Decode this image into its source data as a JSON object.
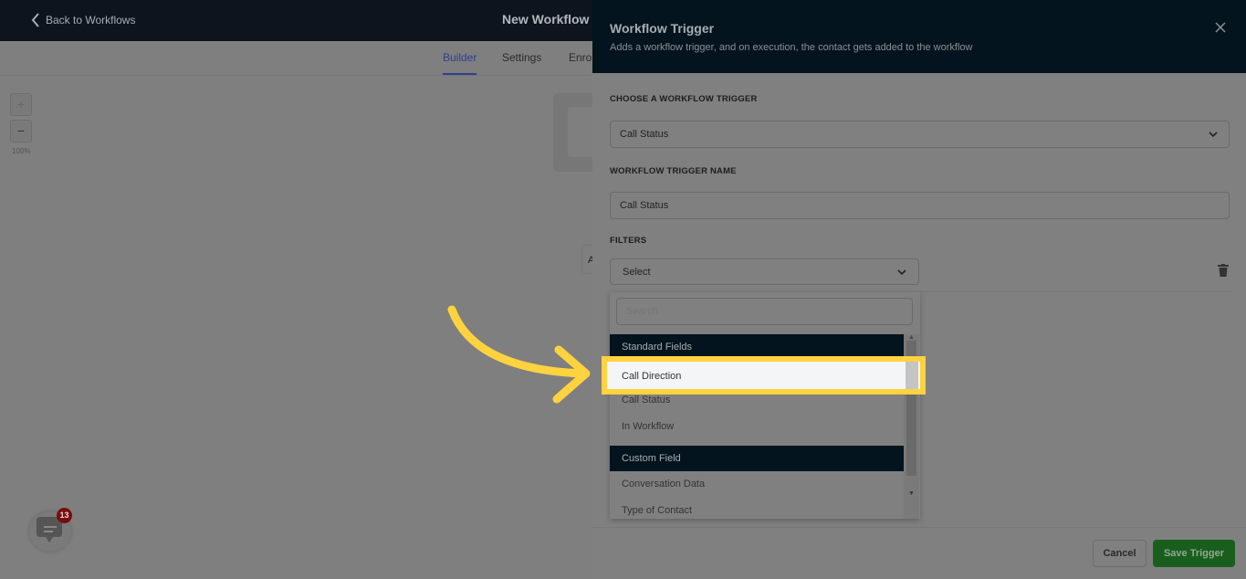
{
  "topbar": {
    "back_label": "Back to Workflows",
    "title": "New Workflow"
  },
  "tabs": [
    {
      "label": "Builder",
      "active": true
    },
    {
      "label": "Settings"
    },
    {
      "label": "Enro"
    }
  ],
  "canvas": {
    "zoom_in": "+",
    "zoom_out": "−",
    "zoom_level": "100%",
    "node_partial": "A"
  },
  "panel": {
    "title": "Workflow Trigger",
    "subtitle": "Adds a workflow trigger, and on execution, the contact gets added to the workflow",
    "choose_label": "CHOOSE A WORKFLOW TRIGGER",
    "choose_value": "Call Status",
    "name_label": "WORKFLOW TRIGGER NAME",
    "name_value": "Call Status",
    "filters_label": "FILTERS",
    "filter_select": "Select",
    "dropdown": {
      "search_placeholder": "Search",
      "groups": [
        {
          "label": "Standard Fields",
          "items": [
            "Call Direction",
            "Call Status",
            "In Workflow"
          ]
        },
        {
          "label": "Custom Field",
          "items": [
            "Conversation Data",
            "Type of Contact"
          ]
        }
      ],
      "highlighted": "Call Direction"
    },
    "cancel": "Cancel",
    "save": "Save Trigger"
  },
  "chat": {
    "badge": "13"
  },
  "colors": {
    "highlight": "#ffd23f",
    "save": "#1a5e1e",
    "header": "#03141e",
    "active_tab": "#2f3f8f"
  }
}
